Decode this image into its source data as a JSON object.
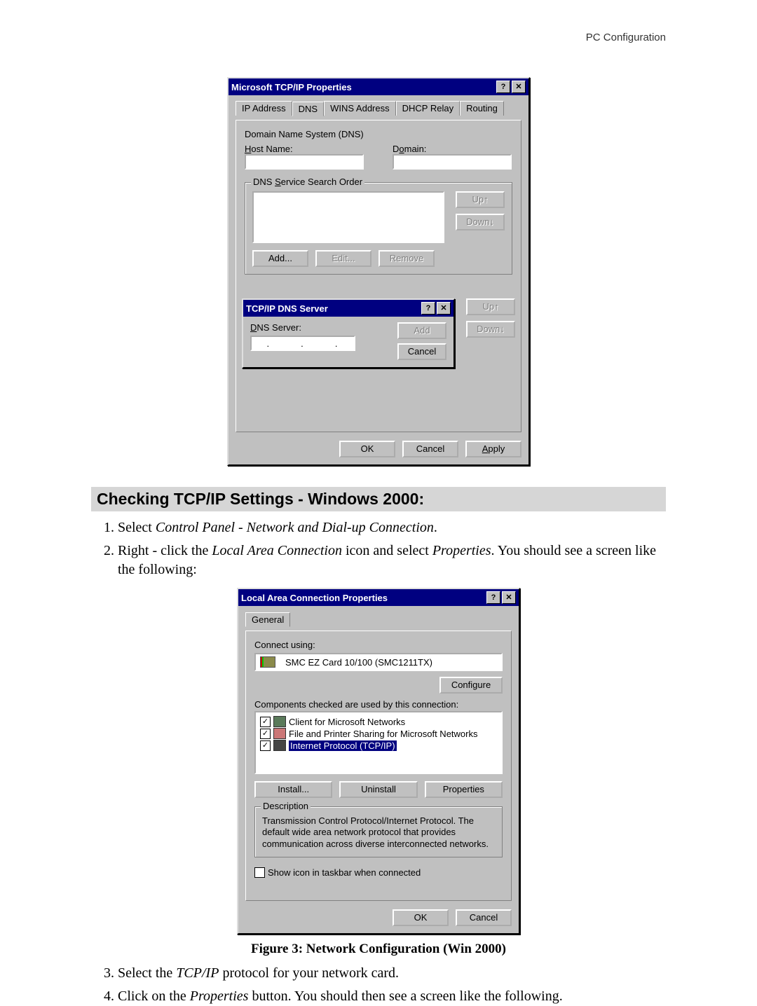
{
  "header": {
    "section": "PC Configuration"
  },
  "figure1": {
    "title": "Microsoft TCP/IP Properties",
    "tabs": [
      "IP Address",
      "DNS",
      "WINS Address",
      "DHCP Relay",
      "Routing"
    ],
    "dns_group": "Domain Name System (DNS)",
    "host_label": "ost Name:",
    "domain_label": "main:",
    "search_order_label": "ervice Search Order",
    "btn_up": "Up",
    "btn_down": "Down",
    "btn_add": "Add...",
    "btn_edit": "Edit...",
    "btn_remove": "Remove",
    "dns_server": {
      "title": "TCP/IP DNS Server",
      "label": "NS Server:",
      "add": "Add",
      "cancel": "Cancel"
    },
    "btn_ok": "OK",
    "btn_cancel": "Cancel",
    "btn_apply": "pply"
  },
  "section2": {
    "heading": "Checking TCP/IP Settings - Windows 2000:",
    "steps": [
      {
        "a": "Select ",
        "b": "Control Panel - Network and Dial-up Connection",
        "c": "."
      },
      {
        "a": "Right - click the ",
        "b": "Local Area Connection",
        "c": " icon and select ",
        "d": "Properties",
        "e": ". You should see a screen like the following:"
      },
      {
        "a": "Select the ",
        "b": "TCP/IP",
        "c": " protocol for your network card."
      },
      {
        "a": "Click on the ",
        "b": "Properties",
        "c": " button. You should then see a screen like the following."
      }
    ]
  },
  "figure3": {
    "title": "Local Area Connection Properties",
    "tab_general": "General",
    "connect_using": "Connect using:",
    "adapter": "SMC EZ Card 10/100 (SMC1211TX)",
    "btn_configure": "Configure",
    "components_label": "Components checked are used by this connection:",
    "components": [
      "Client for Microsoft Networks",
      "File and Printer Sharing for Microsoft Networks",
      "Internet Protocol (TCP/IP)"
    ],
    "btn_install": "Install...",
    "btn_uninstall": "Uninstall",
    "btn_properties": "Properties",
    "desc_label": "Description",
    "desc_text": "Transmission Control Protocol/Internet Protocol. The default wide area network protocol that provides communication across diverse interconnected networks.",
    "show_icon": "Show icon in taskbar when connected",
    "btn_ok": "OK",
    "btn_cancel": "Cancel",
    "caption": "Figure 3: Network Configuration (Win 2000)"
  }
}
